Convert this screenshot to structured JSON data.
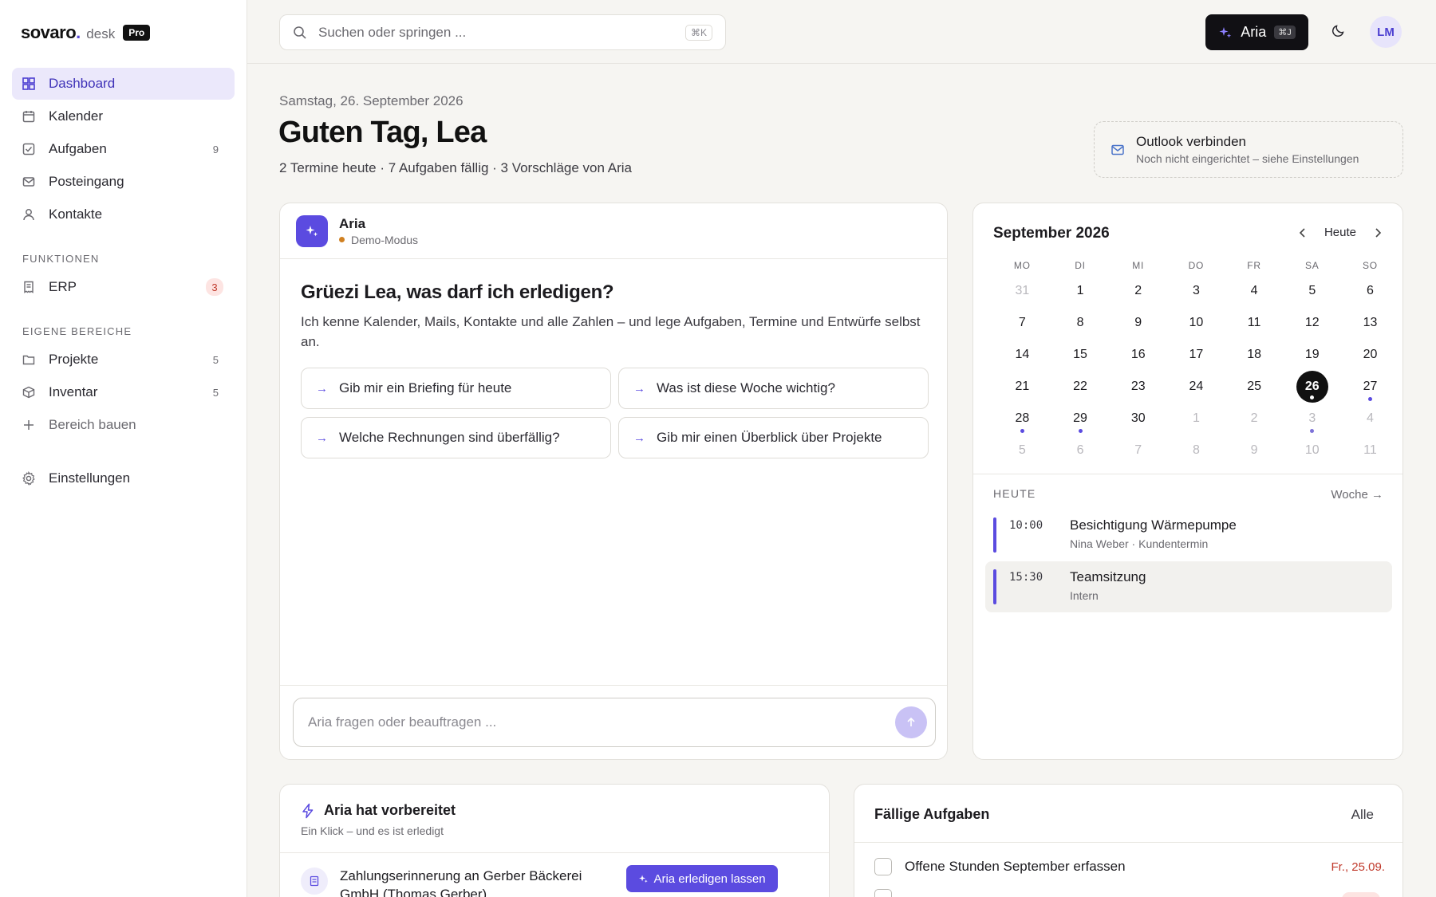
{
  "brand": {
    "name": "sovaro",
    "dot": ".",
    "product": "desk",
    "tier": "Pro"
  },
  "sidebar": {
    "main": [
      {
        "label": "Dashboard",
        "icon": "grid-icon",
        "active": true
      },
      {
        "label": "Kalender",
        "icon": "calendar-icon"
      },
      {
        "label": "Aufgaben",
        "icon": "checkbox-icon",
        "count": "9"
      },
      {
        "label": "Posteingang",
        "icon": "mail-icon"
      },
      {
        "label": "Kontakte",
        "icon": "user-icon"
      }
    ],
    "section_functions": "FUNKTIONEN",
    "functions": [
      {
        "label": "ERP",
        "icon": "receipt-icon",
        "count": "3"
      }
    ],
    "section_own": "EIGENE BEREICHE",
    "own": [
      {
        "label": "Projekte",
        "icon": "folder-icon",
        "count": "5"
      },
      {
        "label": "Inventar",
        "icon": "box-icon",
        "count": "5"
      }
    ],
    "build_label": "Bereich bauen",
    "settings_label": "Einstellungen"
  },
  "topbar": {
    "search_placeholder": "Suchen oder springen ...",
    "search_shortcut": "⌘K",
    "aria_label": "Aria",
    "aria_shortcut": "⌘J",
    "avatar_initials": "LM"
  },
  "greeting": {
    "date": "Samstag, 26. September 2026",
    "title": "Guten Tag, Lea",
    "summary": "2 Termine heute · 7 Aufgaben fällig · 3 Vorschläge von Aria"
  },
  "outlook": {
    "title": "Outlook verbinden",
    "subtitle": "Noch nicht eingerichtet – siehe Einstellungen"
  },
  "chat": {
    "assistant_name": "Aria",
    "mode": "Demo-Modus",
    "headline": "Grüezi Lea, was darf ich erledigen?",
    "intro": "Ich kenne Kalender, Mails, Kontakte und alle Zahlen – und lege Aufgaben, Termine und Entwürfe selbst an.",
    "suggestions": [
      "Gib mir ein Briefing für heute",
      "Was ist diese Woche wichtig?",
      "Welche Rechnungen sind überfällig?",
      "Gib mir einen Überblick über Projekte"
    ],
    "input_placeholder": "Aria fragen oder beauftragen ..."
  },
  "calendar": {
    "month_label": "September 2026",
    "today_button": "Heute",
    "weekdays": [
      "MO",
      "DI",
      "MI",
      "DO",
      "FR",
      "SA",
      "SO"
    ],
    "weeks": [
      [
        {
          "d": "31",
          "dim": true
        },
        {
          "d": "1"
        },
        {
          "d": "2"
        },
        {
          "d": "3"
        },
        {
          "d": "4"
        },
        {
          "d": "5"
        },
        {
          "d": "6"
        }
      ],
      [
        {
          "d": "7"
        },
        {
          "d": "8"
        },
        {
          "d": "9"
        },
        {
          "d": "10"
        },
        {
          "d": "11"
        },
        {
          "d": "12"
        },
        {
          "d": "13"
        }
      ],
      [
        {
          "d": "14"
        },
        {
          "d": "15"
        },
        {
          "d": "16"
        },
        {
          "d": "17"
        },
        {
          "d": "18"
        },
        {
          "d": "19"
        },
        {
          "d": "20"
        }
      ],
      [
        {
          "d": "21"
        },
        {
          "d": "22"
        },
        {
          "d": "23"
        },
        {
          "d": "24"
        },
        {
          "d": "25"
        },
        {
          "d": "26",
          "sel": true,
          "ev": true
        },
        {
          "d": "27",
          "ev": true
        }
      ],
      [
        {
          "d": "28",
          "ev": true
        },
        {
          "d": "29",
          "ev": true
        },
        {
          "d": "30"
        },
        {
          "d": "1",
          "dim": true
        },
        {
          "d": "2",
          "dim": true
        },
        {
          "d": "3",
          "dim": true,
          "ev": true
        },
        {
          "d": "4",
          "dim": true
        }
      ],
      [
        {
          "d": "5",
          "dim": true
        },
        {
          "d": "6",
          "dim": true
        },
        {
          "d": "7",
          "dim": true
        },
        {
          "d": "8",
          "dim": true
        },
        {
          "d": "9",
          "dim": true
        },
        {
          "d": "10",
          "dim": true
        },
        {
          "d": "11",
          "dim": true
        }
      ]
    ],
    "today_label": "HEUTE",
    "week_link": "Woche →",
    "events": [
      {
        "time": "10:00",
        "title": "Besichtigung Wärmepumpe",
        "meta": "Nina Weber · Kundentermin"
      },
      {
        "time": "15:30",
        "title": "Teamsitzung",
        "meta": "Intern",
        "highlight": true
      }
    ]
  },
  "prepared": {
    "title": "Aria hat vorbereitet",
    "subtitle": "Ein Klick – und es ist erledigt",
    "item_text": "Zahlungserinnerung an Gerber Bäckerei GmbH (Thomas Gerber)",
    "action_label": "Aria erledigen lassen"
  },
  "tasks": {
    "title": "Fällige Aufgaben",
    "all_link": "Alle",
    "items": [
      {
        "title": "Offene Stunden September erfassen",
        "due": "Fr., 25.09."
      }
    ]
  },
  "colors": {
    "accent": "#5b4be0",
    "active_bg": "#ebe8fb",
    "danger": "#c0392b",
    "background": "#f6f5f2"
  }
}
